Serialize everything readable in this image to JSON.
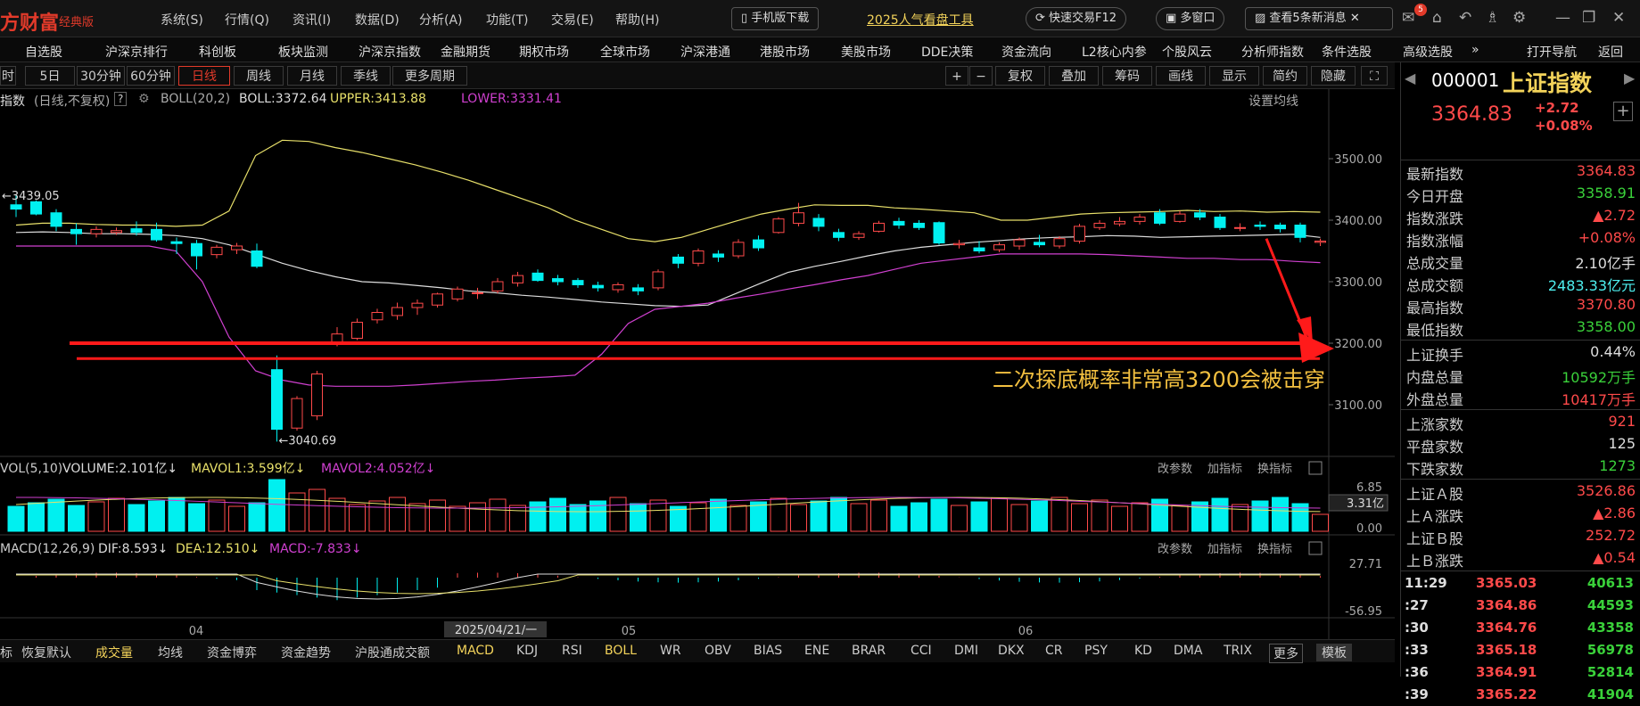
{
  "app": {
    "logo": "方财富",
    "logo_sub": "经典版"
  },
  "menu": [
    "系统(S)",
    "行情(Q)",
    "资讯(I)",
    "数据(D)",
    "分析(A)",
    "功能(T)",
    "交易(E)",
    "帮助(H)"
  ],
  "topbar": {
    "mobile_download": "手机版下载",
    "promo_link": "2025人气看盘工具",
    "quick_trade": "快速交易F12",
    "multi_window": "多窗口",
    "news": "查看5条新消息",
    "msg_count": "5"
  },
  "nav": [
    "自选股",
    "沪深京排行",
    "科创板",
    "板块监测",
    "沪深京指数",
    "金融期货",
    "期权市场",
    "全球市场",
    "沪深港通",
    "港股市场",
    "美股市场",
    "DDE决策",
    "资金流向",
    "L2核心内参",
    "个股风云",
    "分析师指数",
    "条件选股",
    "高级选股",
    "»",
    "打开导航",
    "返回"
  ],
  "tools": {
    "periods": [
      "时",
      "5日",
      "30分钟",
      "60分钟",
      "日线",
      "周线",
      "月线",
      "季线",
      "更多周期"
    ],
    "active": "日线",
    "right": [
      "+",
      "−",
      "复权",
      "叠加",
      "筹码",
      "画线",
      "显示",
      "简约",
      "隐藏"
    ]
  },
  "info": {
    "name": "指数",
    "mode": "(日线,不复权)",
    "help": "?",
    "boll_name": "BOLL(20,2)",
    "boll": "BOLL:3372.64",
    "upper": "UPPER:3413.88",
    "lower": "LOWER:3331.41",
    "set_ma": "设置均线"
  },
  "colors": {
    "up": "#ff4a4a",
    "down": "#00f0f0",
    "mid": "#dddddd",
    "upper": "#e8e06a",
    "lower": "#d040d0",
    "arrow": "#ff1a1a",
    "note": "#f3c040"
  },
  "chart_data": {
    "type": "candlestick",
    "ylim": [
      3050,
      3560
    ],
    "yticks": [
      "3500.00",
      "3400.00",
      "3300.00",
      "3200.00",
      "3100.00"
    ],
    "high_label": "←3439.05",
    "low_label": "←3040.69",
    "annotation": "二次探底概率非常高3200会被击穿",
    "x_labels": [
      "04",
      "05",
      "06"
    ],
    "cursor_date": "2025/04/21/一",
    "candles": [
      [
        3425,
        3418,
        3440,
        3405
      ],
      [
        3430,
        3410,
        3432,
        3408
      ],
      [
        3412,
        3390,
        3418,
        3382
      ],
      [
        3385,
        3378,
        3395,
        3360
      ],
      [
        3378,
        3385,
        3390,
        3372
      ],
      [
        3380,
        3383,
        3388,
        3376
      ],
      [
        3386,
        3380,
        3398,
        3375
      ],
      [
        3385,
        3368,
        3396,
        3365
      ],
      [
        3365,
        3362,
        3372,
        3345
      ],
      [
        3362,
        3342,
        3368,
        3320
      ],
      [
        3344,
        3356,
        3360,
        3338
      ],
      [
        3352,
        3358,
        3363,
        3345
      ],
      [
        3350,
        3325,
        3362,
        3322
      ],
      [
        3157,
        3060,
        3180,
        3040
      ],
      [
        3062,
        3110,
        3114,
        3058
      ],
      [
        3082,
        3150,
        3155,
        3075
      ],
      [
        3200,
        3215,
        3226,
        3195
      ],
      [
        3208,
        3234,
        3240,
        3205
      ],
      [
        3238,
        3250,
        3256,
        3232
      ],
      [
        3245,
        3258,
        3266,
        3238
      ],
      [
        3258,
        3265,
        3271,
        3246
      ],
      [
        3262,
        3280,
        3282,
        3258
      ],
      [
        3272,
        3288,
        3292,
        3268
      ],
      [
        3282,
        3282,
        3290,
        3272
      ],
      [
        3285,
        3300,
        3306,
        3281
      ],
      [
        3298,
        3310,
        3316,
        3292
      ],
      [
        3314,
        3302,
        3320,
        3300
      ],
      [
        3305,
        3300,
        3311,
        3294
      ],
      [
        3302,
        3295,
        3306,
        3290
      ],
      [
        3294,
        3290,
        3300,
        3284
      ],
      [
        3287,
        3295,
        3299,
        3282
      ],
      [
        3290,
        3285,
        3296,
        3278
      ],
      [
        3290,
        3316,
        3320,
        3286
      ],
      [
        3340,
        3330,
        3345,
        3322
      ],
      [
        3330,
        3350,
        3354,
        3325
      ],
      [
        3345,
        3340,
        3351,
        3332
      ],
      [
        3342,
        3364,
        3369,
        3338
      ],
      [
        3368,
        3355,
        3375,
        3350
      ],
      [
        3380,
        3402,
        3405,
        3378
      ],
      [
        3395,
        3412,
        3428,
        3390
      ],
      [
        3403,
        3390,
        3410,
        3382
      ],
      [
        3380,
        3372,
        3386,
        3366
      ],
      [
        3372,
        3378,
        3382,
        3368
      ],
      [
        3382,
        3395,
        3399,
        3380
      ],
      [
        3398,
        3392,
        3404,
        3386
      ],
      [
        3395,
        3388,
        3400,
        3384
      ],
      [
        3396,
        3363,
        3398,
        3360
      ],
      [
        3360,
        3362,
        3368,
        3354
      ],
      [
        3355,
        3350,
        3366,
        3346
      ],
      [
        3352,
        3360,
        3364,
        3348
      ],
      [
        3358,
        3368,
        3372,
        3352
      ],
      [
        3364,
        3360,
        3376,
        3356
      ],
      [
        3358,
        3370,
        3374,
        3354
      ],
      [
        3366,
        3390,
        3394,
        3362
      ],
      [
        3388,
        3395,
        3400,
        3384
      ],
      [
        3394,
        3398,
        3405,
        3390
      ],
      [
        3398,
        3405,
        3410,
        3393
      ],
      [
        3412,
        3395,
        3418,
        3392
      ],
      [
        3398,
        3410,
        3415,
        3396
      ],
      [
        3412,
        3405,
        3418,
        3400
      ],
      [
        3405,
        3388,
        3410,
        3384
      ],
      [
        3388,
        3388,
        3395,
        3382
      ],
      [
        3392,
        3390,
        3398,
        3384
      ],
      [
        3392,
        3386,
        3396,
        3380
      ],
      [
        3392,
        3372,
        3396,
        3364
      ],
      [
        3364,
        3366,
        3370,
        3358
      ]
    ],
    "mid": [
      3380,
      3381,
      3380,
      3378,
      3378,
      3377,
      3375,
      3370,
      3360,
      3345,
      3330,
      3318,
      3308,
      3300,
      3298,
      3294,
      3290,
      3285,
      3282,
      3278,
      3275,
      3271,
      3267,
      3264,
      3261,
      3260,
      3262,
      3280,
      3298,
      3315,
      3325,
      3333,
      3342,
      3350,
      3356,
      3360,
      3364,
      3367,
      3370,
      3372,
      3373,
      3375,
      3374,
      3372,
      3373,
      3374,
      3375,
      3376,
      3377,
      3372
    ],
    "upper": [
      3392,
      3395,
      3395,
      3393,
      3392,
      3392,
      3390,
      3392,
      3415,
      3505,
      3530,
      3528,
      3518,
      3510,
      3500,
      3490,
      3478,
      3465,
      3450,
      3435,
      3420,
      3400,
      3385,
      3370,
      3365,
      3372,
      3385,
      3398,
      3410,
      3418,
      3425,
      3424,
      3424,
      3420,
      3418,
      3415,
      3412,
      3400,
      3400,
      3405,
      3410,
      3412,
      3413,
      3414,
      3416,
      3414,
      3415,
      3413,
      3414,
      3413
    ],
    "lower": [
      3358,
      3358,
      3358,
      3358,
      3358,
      3358,
      3350,
      3300,
      3210,
      3155,
      3140,
      3132,
      3130,
      3130,
      3130,
      3132,
      3135,
      3138,
      3140,
      3143,
      3145,
      3148,
      3182,
      3232,
      3255,
      3260,
      3265,
      3273,
      3280,
      3288,
      3295,
      3303,
      3310,
      3320,
      3330,
      3335,
      3340,
      3345,
      3345,
      3345,
      3345,
      3344,
      3342,
      3340,
      3338,
      3338,
      3336,
      3336,
      3333,
      3331
    ]
  },
  "vol": {
    "title": "VOL(5,10)",
    "volume": "VOLUME:2.101亿",
    "mavol1": "MAVOL1:3.599亿",
    "mavol2": "MAVOL2:4.052亿",
    "ticks": [
      "6.85",
      "0.00"
    ],
    "current": "3.31亿",
    "buttons": [
      "改参数",
      "加指标",
      "换指标"
    ]
  },
  "macd": {
    "title": "MACD(12,26,9)",
    "dif": "DIF:8.593",
    "dea": "DEA:12.510",
    "macd": "MACD:-7.833",
    "ticks": [
      "27.71",
      "-56.95"
    ],
    "buttons": [
      "改参数",
      "加指标",
      "换指标"
    ]
  },
  "bottom": [
    "标",
    "恢复默认",
    "成交量",
    "均线",
    "资金博弈",
    "资金趋势",
    "沪股通成交额",
    "MACD",
    "KDJ",
    "RSI",
    "BOLL",
    "WR",
    "OBV",
    "BIAS",
    "ENE",
    "BRAR",
    "CCI",
    "DMI",
    "DKX",
    "CR",
    "PSY",
    "KD",
    "DMA",
    "TRIX",
    "更多",
    "模板"
  ],
  "quote": {
    "code": "000001",
    "name": "上证指数",
    "price": "3364.83",
    "change": "+2.72",
    "pct": "+0.08%",
    "rows1": [
      {
        "label": "最新指数",
        "value": "3364.83",
        "color": "red"
      },
      {
        "label": "今日开盘",
        "value": "3358.91",
        "color": "green"
      },
      {
        "label": "指数涨跌",
        "value": "▲2.72",
        "color": "red"
      },
      {
        "label": "指数涨幅",
        "value": "+0.08%",
        "color": "red"
      },
      {
        "label": "总成交量",
        "value": "2.10亿手",
        "color": "white"
      },
      {
        "label": "总成交额",
        "value": "2483.33亿元",
        "color": "cyan"
      },
      {
        "label": "最高指数",
        "value": "3370.80",
        "color": "red"
      },
      {
        "label": "最低指数",
        "value": "3358.00",
        "color": "green"
      }
    ],
    "rows2": [
      {
        "label": "上证换手",
        "value": "0.44%",
        "color": "white"
      },
      {
        "label": "内盘总量",
        "value": "10592万手",
        "color": "green"
      },
      {
        "label": "外盘总量",
        "value": "10417万手",
        "color": "red"
      }
    ],
    "rows3": [
      {
        "label": "上涨家数",
        "value": "921",
        "color": "red"
      },
      {
        "label": "平盘家数",
        "value": "125",
        "color": "white"
      },
      {
        "label": "下跌家数",
        "value": "1273",
        "color": "green"
      }
    ],
    "rows4": [
      {
        "label": "上证Ａ股",
        "value": "3526.86",
        "color": "red"
      },
      {
        "label": "上Ａ涨跌",
        "value": "▲2.86",
        "color": "red"
      },
      {
        "label": "上证Ｂ股",
        "value": "252.72",
        "color": "red"
      },
      {
        "label": "上Ｂ涨跌",
        "value": "▲0.54",
        "color": "red"
      }
    ],
    "ticks": [
      {
        "time": "11:29",
        "price": "3365.03",
        "vol": "40613"
      },
      {
        "time": ":27",
        "price": "3364.86",
        "vol": "44593"
      },
      {
        "time": ":30",
        "price": "3364.76",
        "vol": "43358"
      },
      {
        "time": ":33",
        "price": "3365.18",
        "vol": "56978"
      },
      {
        "time": ":36",
        "price": "3364.91",
        "vol": "52814"
      },
      {
        "time": ":39",
        "price": "3365.22",
        "vol": "41904"
      }
    ]
  }
}
